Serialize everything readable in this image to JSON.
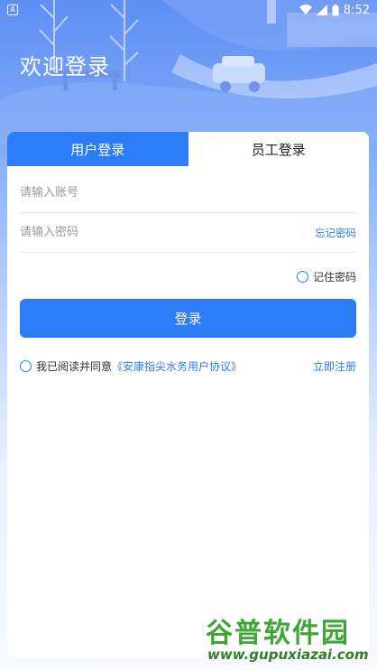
{
  "status_bar": {
    "notification_icon": "A",
    "time": "8:52",
    "icons": [
      "wifi-icon",
      "cell-signal-icon",
      "battery-icon"
    ]
  },
  "header": {
    "title": "欢迎登录"
  },
  "tabs": [
    {
      "label": "用户登录",
      "active": true
    },
    {
      "label": "员工登录",
      "active": false
    }
  ],
  "form": {
    "account_placeholder": "请输入账号",
    "password_placeholder": "请输入密码",
    "forgot_password": "忘记密码",
    "remember_password": "记住密码",
    "login_button": "登录"
  },
  "agreement": {
    "prefix": "我已阅读并同意",
    "link": "《安康指尖水务用户协议》",
    "register": "立即注册"
  },
  "watermark": {
    "title": "谷普软件园",
    "url": "www.gupuxiazai.com"
  },
  "colors": {
    "accent": "#2b7cf6",
    "header_gradient_top": "#5c8ef5",
    "watermark_green": "#3fa535"
  }
}
